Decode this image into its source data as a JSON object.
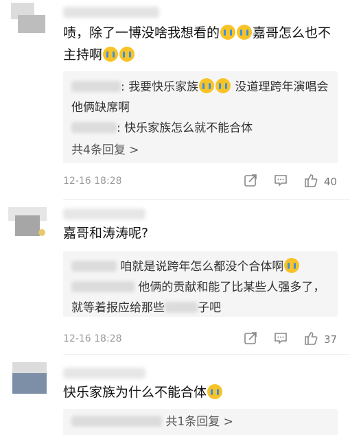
{
  "comments": [
    {
      "text_parts": [
        "啧，除了一博没啥我想看的",
        "嘉哥怎么也不主持啊"
      ],
      "replies": [
        {
          "text": "我要快乐家族",
          "text_after": "没道理跨年演唱会他俩缺席啊"
        },
        {
          "text": "快乐家族怎么就不能合体"
        }
      ],
      "more_replies": "共4条回复 >",
      "time": "12-16 18:28",
      "likes": "40"
    },
    {
      "text": "嘉哥和涛涛呢?",
      "replies": [
        {
          "text": "咱就是说跨年怎么都没个合体啊"
        },
        {
          "text": "他俩的贡献和能了比某些人强多了，就等着报应给那些",
          "text_after": "子吧"
        }
      ],
      "time": "12-16 18:28",
      "likes": "37"
    },
    {
      "text": "快乐家族为什么不能合体",
      "more_replies": "共1条回复 >"
    }
  ],
  "icons": {
    "share": "share-icon",
    "comment": "comment-icon",
    "like": "thumbs-up-icon",
    "emoji": "crying-face-emoji"
  },
  "colors": {
    "reply_bg": "#f5f5f5",
    "meta_text": "#999999",
    "emoji": "#f7c327"
  }
}
